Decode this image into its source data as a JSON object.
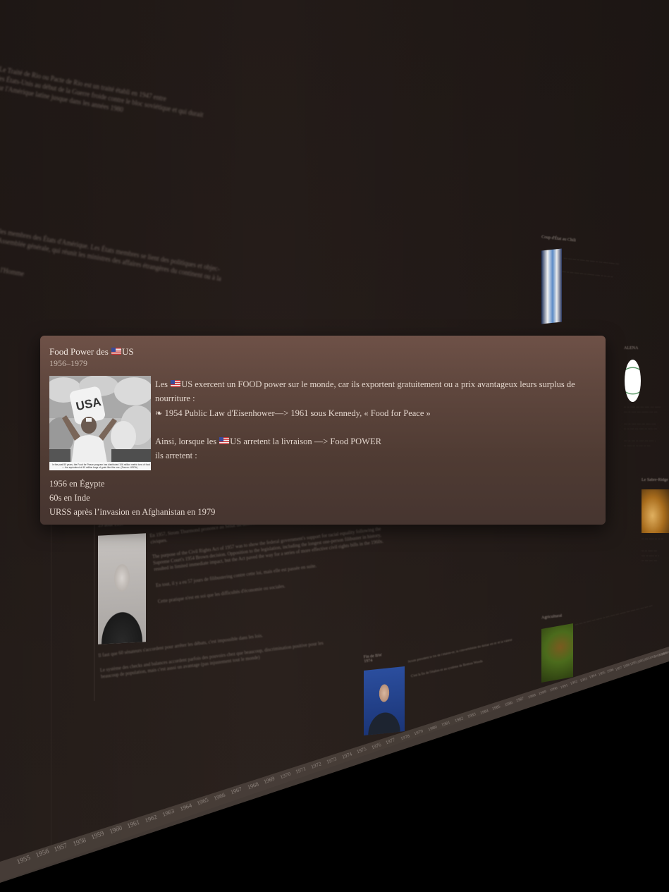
{
  "card": {
    "title_prefix": "Food Power des ",
    "title_suffix": "US",
    "dates": "1956–1979",
    "image_caption": "In the past 50 years, the Food for Peace program has distributed 106 million metric tons of food — the equivalent of 40 million bags of grain like this one. (Source: USDA)",
    "image_sack_label": "USA",
    "body": {
      "line1_a": "Les ",
      "line1_b": "US  exercent un FOOD power sur le monde, car ils exportent gratuitement ou a prix avantageux leurs surplus de nourriture :",
      "line2": "❧ 1954 Public Law d'Eisenhower—>  1961 sous Kennedy, « Food for Peace »",
      "line3_a": "Ainsi, lorsque les  ",
      "line3_b": "US arretent la livraison —> Food POWER",
      "line4": "ils arretent :"
    },
    "list": [
      "1956 en Égypte",
      "60s en Inde",
      "URSS après l’invasion en Afghanistan en 1979"
    ]
  },
  "background": {
    "text_blocks": [
      "Le Traité de Rio ou Pacte de Rio est un traité établi en 1947 entre",
      "les États-Unis au début de la Guerre froide contre le bloc soviétique et qui durait",
      "sur l'Amérique latine jusque dans les années 1980",
      "les membres des États d'Amérique. Les États membres se lient des politiques et objec-",
      "Assemblée générale, qui réunit les ministres des affaires étrangères du continent ou à la",
      "de l'Homme",
      "En 1957, Strom Thurmond prononce au Sénat un discours de 24 heures et 18 minutes contre",
      "civiques.",
      "The purpose of the Civil Rights Act of 1957 was to show the federal government's support for racial equality following the",
      "Supreme Court's 1954 Brown decision. Opposition to the legislation, including the longest one-person filibuster in history,",
      "resulted in limited immediate impact, but the Act paved the way for a series of more effective civil rights bills in the 1960s.",
      "En tout, il y a eu 57 jours de filibustering contre cette loi, mais elle est passée en suite.",
      "Cette pratique n'est en soi que les difficultés d'économie ou sociales.",
      "Il faut que 60 sénateurs s'accordent pour arrêter les débats, c'est impossible dans les lois.",
      "Le système des checks and balances accordent parfois des pouvoirs chez que beaucoup, discrimination positive pour les",
      "beaucoup de population, mais c'est aussi un avantage (pas injustement tout le monde)"
    ],
    "event_titles": [
      "Coup d'État au Chili",
      "1973",
      "Fin de BW",
      "1974",
      "Agricultural",
      "1980",
      "ALENA",
      "1994",
      "Le Sabre-Ridge",
      "1989"
    ],
    "subtitle_date": "29 août 1957",
    "nixon_text": [
      "Nixon président le fin de l'étalon-or, la convertibilité du dollar en or et la valeur",
      "C'est la fin de l'étalon-or au système de Bretton Woods"
    ],
    "years": [
      "1955",
      "1956",
      "1957",
      "1958",
      "1959",
      "1960",
      "1961",
      "1962",
      "1963",
      "1964",
      "1965",
      "1966",
      "1967",
      "1968",
      "1969",
      "1970",
      "1971",
      "1972",
      "1973",
      "1974",
      "1975",
      "1976",
      "1977",
      "1978",
      "1979",
      "1980",
      "1981",
      "1982",
      "1983",
      "1984",
      "1985",
      "1986",
      "1987",
      "1988",
      "1989",
      "1990",
      "1991",
      "1992",
      "1993",
      "1994",
      "1995",
      "1996",
      "1997",
      "1998",
      "1999",
      "2000",
      "2001",
      "2002",
      "2003",
      "2004",
      "2005",
      "2006"
    ]
  },
  "colors": {
    "background": "#261d1a",
    "card_top": "#6e5147",
    "card_bottom": "#463530",
    "text": "#e3d6cd"
  }
}
